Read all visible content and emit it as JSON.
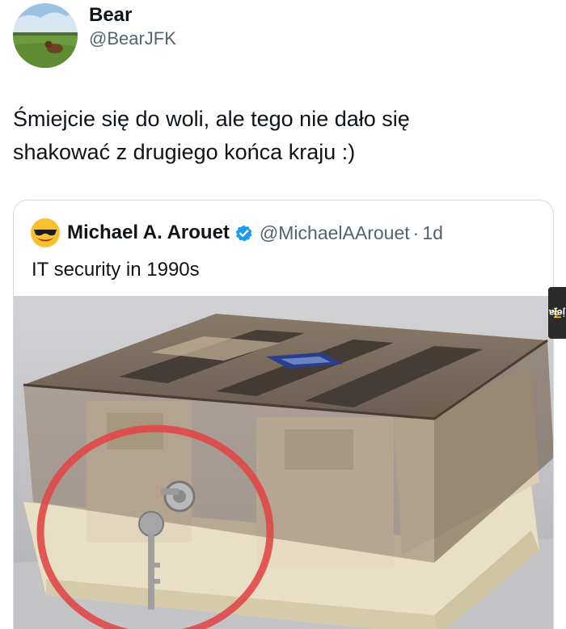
{
  "author": {
    "name": "Bear",
    "handle": "@BearJFK",
    "avatar_icon": "dog-in-field-avatar"
  },
  "tweet": {
    "text": "Śmiejcie się do woli, ale tego nie dało się\nshakować z drugiego końca kraju :)"
  },
  "quoted": {
    "name": "Michael A. Arouet",
    "handle": "@MichaelAArouet",
    "separator": "·",
    "time": "1d",
    "text": "IT security in 1990s",
    "avatar_icon": "smiley-sunglasses-avatar",
    "verified_icon": "verified-badge-icon",
    "media_icon": "locked-floppy-disk-box-photo"
  },
  "watermark": {
    "text": "jeja",
    "suffix": ".pl"
  },
  "colors": {
    "text": "#0f1419",
    "secondary": "#536471",
    "border": "#cfd9de",
    "verified": "#1d9bf0",
    "highlight_circle": "#e04848"
  }
}
